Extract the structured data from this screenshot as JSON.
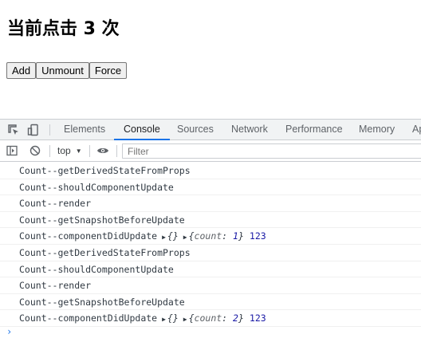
{
  "page": {
    "heading": "当前点击 3 次",
    "buttons": [
      "Add",
      "Unmount",
      "Force"
    ]
  },
  "devtools": {
    "tabs": [
      "Elements",
      "Console",
      "Sources",
      "Network",
      "Performance",
      "Memory",
      "Ap"
    ],
    "active_tab": "Console",
    "context": "top",
    "filter_placeholder": "Filter",
    "icons": [
      "inspect-icon",
      "device-toolbar-icon",
      "sidebar-toggle-icon",
      "clear-console-icon",
      "dropdown-caret-icon",
      "eye-icon"
    ],
    "accent_color": "#1a73e8"
  },
  "console": {
    "rows": [
      {
        "text": "Count--getDerivedStateFromProps"
      },
      {
        "text": "Count--shouldComponentUpdate"
      },
      {
        "text": "Count--render"
      },
      {
        "text": "Count--getSnapshotBeforeUpdate"
      },
      {
        "text": "Count--componentDidUpdate",
        "obj1": "{}",
        "obj2_key": "count",
        "obj2_val": "1",
        "extra": "123"
      },
      {
        "text": "Count--getDerivedStateFromProps"
      },
      {
        "text": "Count--shouldComponentUpdate"
      },
      {
        "text": "Count--render"
      },
      {
        "text": "Count--getSnapshotBeforeUpdate"
      },
      {
        "text": "Count--componentDidUpdate",
        "obj1": "{}",
        "obj2_key": "count",
        "obj2_val": "2",
        "extra": "123"
      }
    ],
    "prompt": "›"
  }
}
